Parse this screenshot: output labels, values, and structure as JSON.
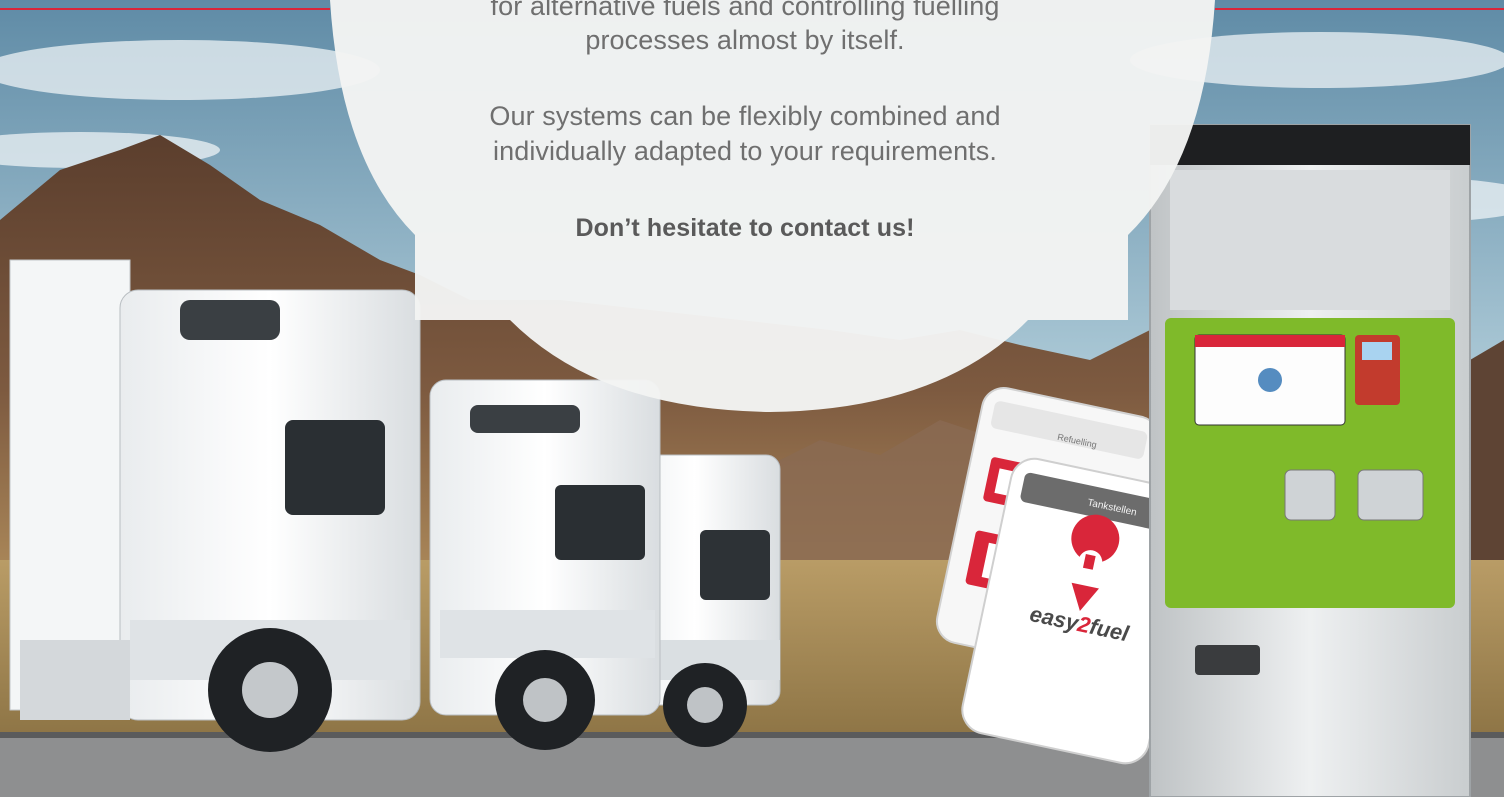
{
  "bubble": {
    "line1": "for alternative fuels and controlling fuelling",
    "line2": "processes almost by itself.",
    "para2_line1": "Our systems can be flexibly combined and",
    "para2_line2": "individually adapted to your requirements.",
    "cta": "Don’t hesitate to contact us!"
  },
  "phone_back": {
    "header": "Refuelling"
  },
  "phone_front": {
    "header": "Tankstellen",
    "logo_left": "easy",
    "logo_right": "fuel"
  },
  "colors": {
    "accent_red": "#d9263a",
    "terminal_green": "#7fba2a",
    "sky": "#9fc0cf",
    "mountain": "#6c4a35"
  },
  "icons": [
    "fuel-pin-icon",
    "fuel-pump-icon",
    "back-arrow-icon",
    "menu-icon"
  ]
}
